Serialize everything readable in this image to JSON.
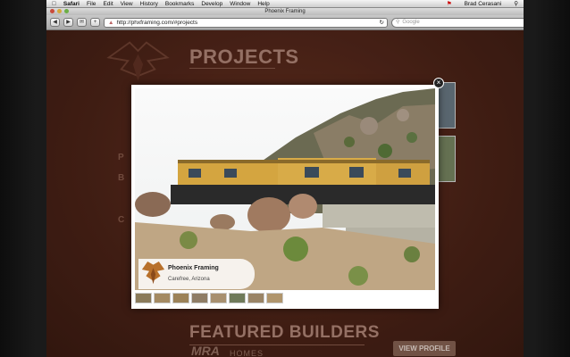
{
  "menubar": {
    "apple_icon": "apple-icon",
    "app": "Safari",
    "items": [
      "File",
      "Edit",
      "View",
      "History",
      "Bookmarks",
      "Develop",
      "Window",
      "Help"
    ],
    "user": "Brad Cerasani"
  },
  "window": {
    "title": "Phoenix Framing",
    "url": "http://phxframing.com/#projects",
    "search_placeholder": "Google"
  },
  "page": {
    "projects_heading": "PROJECTS",
    "featured_heading": "FEATURED BUILDERS",
    "side_labels": [
      "P",
      "B",
      "C"
    ],
    "builder_logo": "MRA",
    "builder_logo_sub": "HOMES",
    "view_profile_label": "VIEW PROFILE"
  },
  "lightbox": {
    "caption_title": "Phoenix Framing",
    "caption_location": "Carefree, Arizona",
    "close_label": "×",
    "thumbnail_count": 8
  },
  "colors": {
    "page_bg": "#4e2418",
    "heading": "#b5897a",
    "button": "#8a6555"
  }
}
